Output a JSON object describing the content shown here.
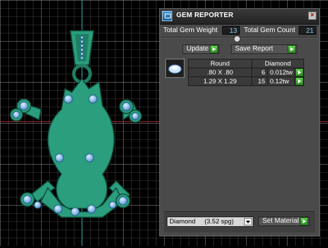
{
  "window": {
    "title": "GEM REPORTER",
    "close_glyph": "×"
  },
  "totals": {
    "weight_label": "Total Gem Weight",
    "weight_value": "13",
    "count_label": "Total Gem Count",
    "count_value": "21"
  },
  "actions": {
    "update_label": "Update",
    "save_label": "Save Report"
  },
  "gem_table": {
    "headers": [
      "Round",
      "Diamond"
    ],
    "rows": [
      {
        "size": ".80 X .80",
        "qty": "6",
        "weight": "0.012tw"
      },
      {
        "size": "1.29 X 1.29",
        "qty": "15",
        "weight": "0.12tw"
      }
    ]
  },
  "material": {
    "selected": "Diamond     (3.52 spg)",
    "set_label": "Set Material"
  },
  "icons": [
    "app-icon",
    "close-icon",
    "collapse-icon",
    "go-arrow-icon",
    "dropdown-arrow-icon",
    "gem-icon"
  ],
  "colors": {
    "model_green": "#2a9e7d",
    "gem_blue": "#8ab8e8",
    "accent_green": "#3faf30",
    "grid_line": "#8a8a8a"
  }
}
